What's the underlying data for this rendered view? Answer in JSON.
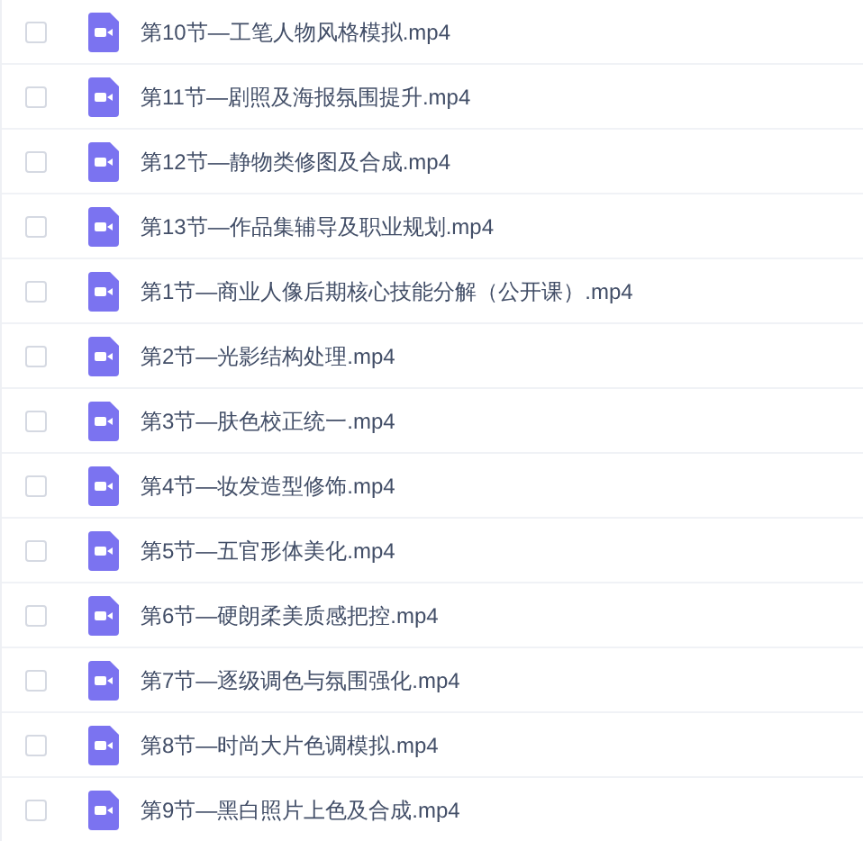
{
  "files": [
    {
      "name": "第10节—工笔人物风格模拟.mp4",
      "checked": false
    },
    {
      "name": "第11节—剧照及海报氛围提升.mp4",
      "checked": false
    },
    {
      "name": "第12节—静物类修图及合成.mp4",
      "checked": false
    },
    {
      "name": "第13节—作品集辅导及职业规划.mp4",
      "checked": false
    },
    {
      "name": "第1节—商业人像后期核心技能分解（公开课）.mp4",
      "checked": false
    },
    {
      "name": "第2节—光影结构处理.mp4",
      "checked": false
    },
    {
      "name": "第3节—肤色校正统一.mp4",
      "checked": false
    },
    {
      "name": "第4节—妆发造型修饰.mp4",
      "checked": false
    },
    {
      "name": "第5节—五官形体美化.mp4",
      "checked": false
    },
    {
      "name": "第6节—硬朗柔美质感把控.mp4",
      "checked": false
    },
    {
      "name": "第7节—逐级调色与氛围强化.mp4",
      "checked": false
    },
    {
      "name": "第8节—时尚大片色调模拟.mp4",
      "checked": false
    },
    {
      "name": "第9节—黑白照片上色及合成.mp4",
      "checked": false
    }
  ]
}
